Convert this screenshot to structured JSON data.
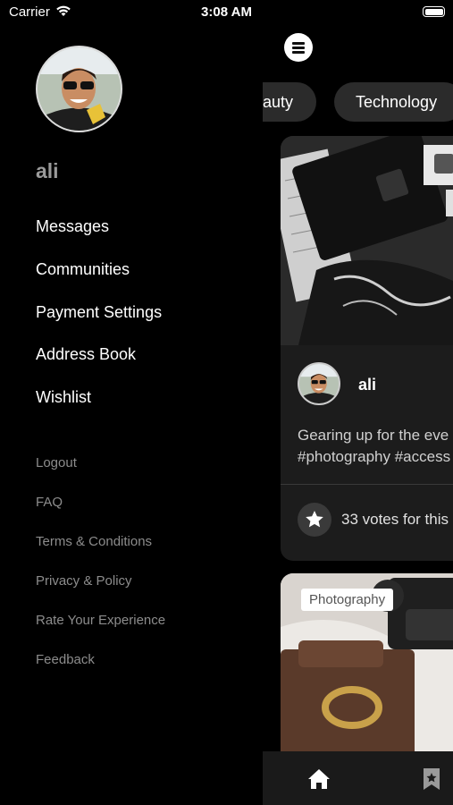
{
  "status_bar": {
    "carrier": "Carrier",
    "time": "3:08 AM",
    "wifi_icon": "wifi-icon",
    "battery_icon": "battery-icon"
  },
  "drawer": {
    "username": "ali",
    "main_menu": [
      {
        "label": "Messages"
      },
      {
        "label": "Communities"
      },
      {
        "label": "Payment Settings"
      },
      {
        "label": "Address Book"
      },
      {
        "label": "Wishlist"
      }
    ],
    "secondary_menu": [
      {
        "label": "Logout"
      },
      {
        "label": "FAQ"
      },
      {
        "label": "Terms & Conditions"
      },
      {
        "label": "Privacy & Policy"
      },
      {
        "label": "Rate Your Experience"
      },
      {
        "label": "Feedback"
      }
    ]
  },
  "content": {
    "menu_icon": "hamburger-icon",
    "categories": [
      "Beauty",
      "Technology"
    ],
    "post": {
      "author": "ali",
      "caption_line1": "Gearing up for the eve",
      "caption_line2": "#photography #access",
      "votes": "33 votes for this"
    },
    "post2": {
      "tag": "Photography"
    },
    "tabbar": {
      "home_icon": "home-icon",
      "bookmark_icon": "bookmark-icon"
    }
  },
  "colors": {
    "background": "#000000",
    "chip": "#2b2b2b",
    "card": "#1c1c1c",
    "muted_text": "#8c8c8c"
  }
}
